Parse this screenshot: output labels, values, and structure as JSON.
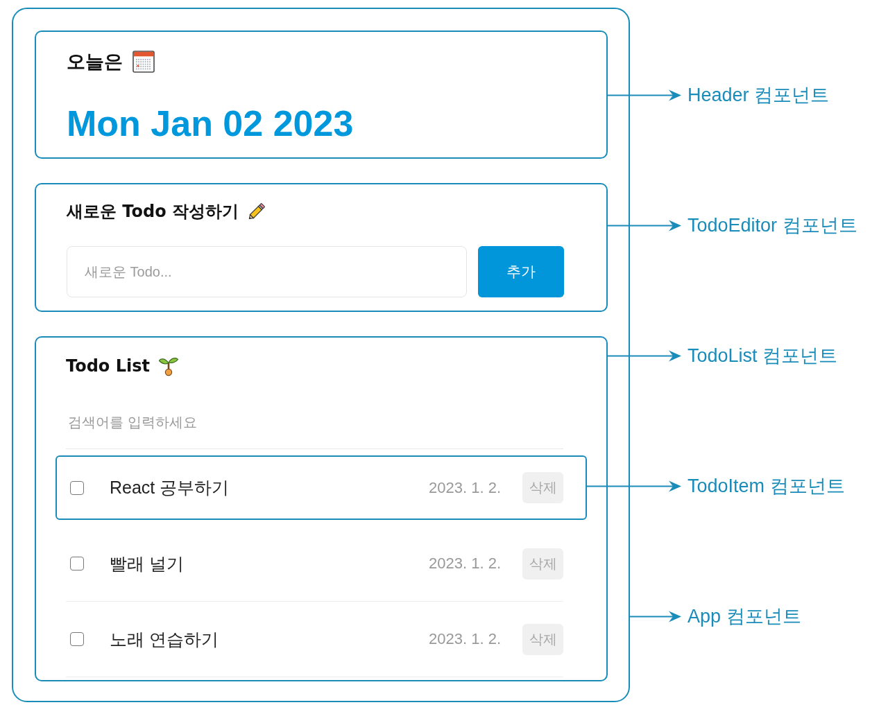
{
  "app": {
    "header": {
      "label": "오늘은",
      "date": "Mon Jan 02 2023",
      "annotation": "Header 컴포넌트"
    },
    "editor": {
      "title": "새로운 Todo 작성하기",
      "input": {
        "placeholder": "새로운 Todo..."
      },
      "add_button": "추가",
      "annotation": "TodoEditor 컴포넌트"
    },
    "todo_list": {
      "title": "Todo List",
      "annotation": "TodoList 컴포넌트",
      "search": {
        "placeholder": "검색어를 입력하세요"
      },
      "todos": [
        {
          "checked": false,
          "content": "React 공부하기",
          "date": "2023. 1. 2.",
          "delete_button": "삭제",
          "annotation": "TodoItem 컴포넌트"
        },
        {
          "checked": false,
          "content": "빨래 널기",
          "date": "2023. 1. 2.",
          "delete_button": "삭제"
        },
        {
          "checked": false,
          "content": "노래 연습하기",
          "date": "2023. 1. 2.",
          "delete_button": "삭제"
        }
      ]
    },
    "annotation": "App 컴포넌트"
  }
}
